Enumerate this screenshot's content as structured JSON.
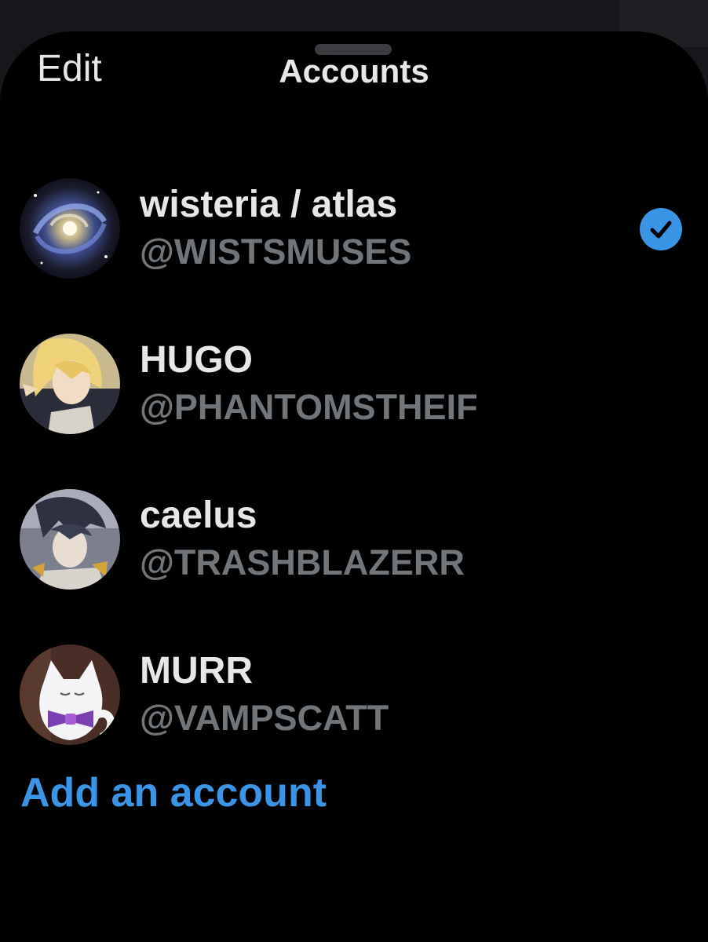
{
  "header": {
    "edit_label": "Edit",
    "title": "Accounts"
  },
  "accounts": [
    {
      "display_name": "wisteria / atlas",
      "handle": "@WISTSMUSES",
      "selected": true,
      "avatar": "galaxy-avatar"
    },
    {
      "display_name": "HUGO",
      "handle": "@PHANTOMSTHEIF",
      "selected": false,
      "avatar": "blond-character-avatar"
    },
    {
      "display_name": "caelus",
      "handle": "@TRASHBLAZERR",
      "selected": false,
      "avatar": "dark-haired-character-avatar"
    },
    {
      "display_name": "MURR",
      "handle": "@VAMPSCATT",
      "selected": false,
      "avatar": "white-cat-avatar"
    }
  ],
  "add_account_label": "Add an account",
  "colors": {
    "background": "#000000",
    "primary_text": "#e7e7e9",
    "secondary_text": "#71767b",
    "accent": "#3b95e6",
    "checkmark_badge": "#3b95e6"
  },
  "icons": {
    "selected_indicator": "check-circle-icon"
  }
}
